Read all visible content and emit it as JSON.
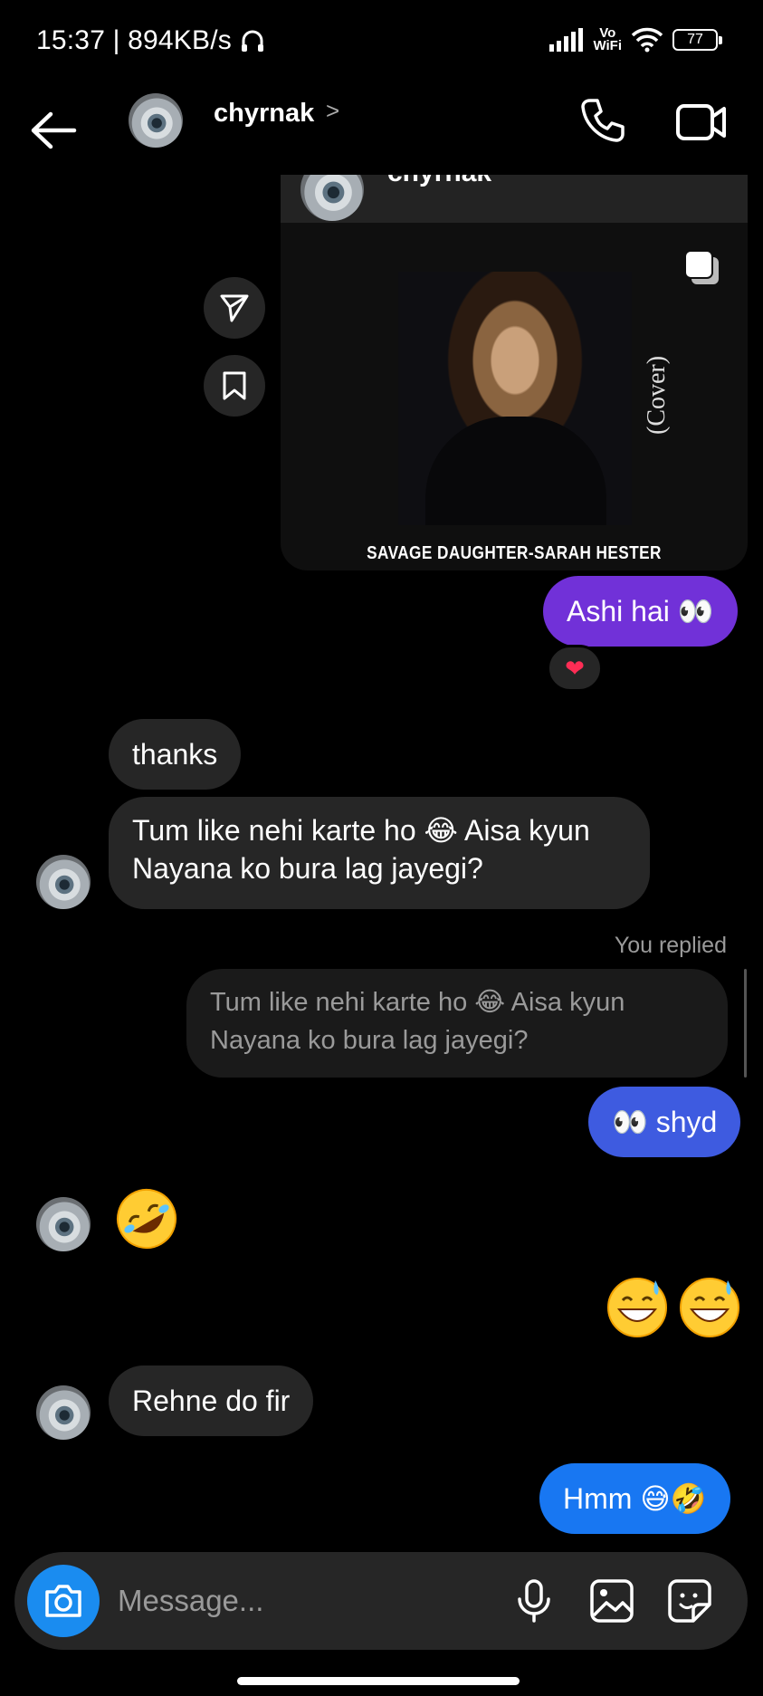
{
  "status_bar": {
    "time_speed": "15:37 | 894KB/s",
    "vowifi_top": "Vo",
    "vowifi_bottom": "WiFi",
    "battery": "77"
  },
  "header": {
    "name": "chyrnak",
    "chevron": ">"
  },
  "shared_post": {
    "author": "chyrnak",
    "cover_text": "(Cover)",
    "caption": "SAVAGE DAUGHTER-SARAH HESTER"
  },
  "messages": {
    "m1": "Ashi hai 👀",
    "m1_reaction": "❤",
    "m2": "thanks",
    "m3_line1": "Tum like nehi karte ho 😂 Aisa kyun",
    "m3_line2": "Nayana ko bura lag jayegi?",
    "reply_label": "You replied",
    "reply_line1": "Tum like nehi karte ho 😂 Aisa kyun",
    "reply_line2": "Nayana ko bura lag jayegi?",
    "m4": "👀 shyd",
    "m5_emoji": "rolling-on-floor-laughing",
    "m6_emoji": "grinning-sweat-x2",
    "m7": "Rehne do fir",
    "m8": "Hmm 😅🤣"
  },
  "composer": {
    "placeholder": "Message..."
  },
  "colors": {
    "accent_purple": "#7131d8",
    "accent_blue": "#3e5be0",
    "accent_blue_bright": "#1877f2",
    "camera_button": "#1a8cf0"
  }
}
